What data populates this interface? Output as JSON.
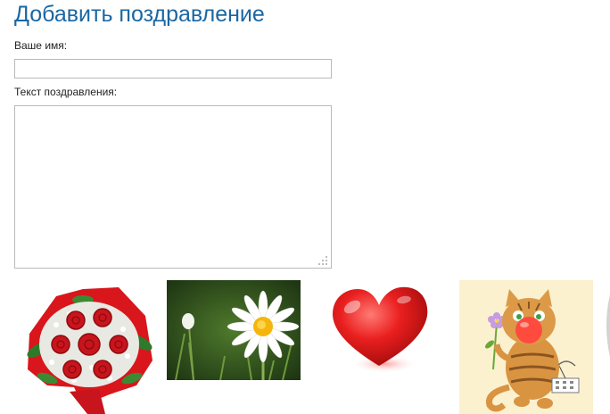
{
  "form": {
    "title": "Добавить поздравление",
    "name_label": "Ваше имя:",
    "name_value": "",
    "text_label": "Текст поздравления:",
    "text_value": ""
  },
  "gifts": [
    {
      "icon": "rose-bouquet-icon"
    },
    {
      "icon": "daisy-icon"
    },
    {
      "icon": "red-heart-icon"
    },
    {
      "icon": "cat-with-flower-icon"
    }
  ],
  "colors": {
    "title": "#1a67a3",
    "border": "#b9b9b9",
    "heart": "#e41d1d",
    "rose": "#c8141c",
    "cat_background": "#fbf1cf"
  }
}
